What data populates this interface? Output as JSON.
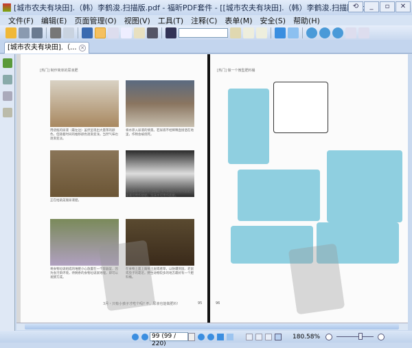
{
  "window": {
    "title": "[城市农夫有块田].（韩）李鹤浚.扫描版.pdf - 福昕PDF套件 - [[城市农夫有块田].（韩）李鹤浚.扫描版.pdf]",
    "buttons": [
      "⟲",
      "_",
      "▫",
      "✕"
    ]
  },
  "menu": [
    "文件(F)",
    "编辑(E)",
    "页面管理(O)",
    "视图(V)",
    "工具(T)",
    "注释(C)",
    "表单(M)",
    "安全(S)",
    "帮助(H)"
  ],
  "search": {
    "value": ""
  },
  "tab": {
    "label": "[城市农夫有块田].（...",
    "close": "✕"
  },
  "left_page": {
    "header": "[热门] 制作简单的尿液肥",
    "captions": [
      "用烧瓶的尿液（最左边）虽然呈现出大量茶的颜色，但随着时间的推移颜色逐渐变浅，当然气味也逐渐变淡。",
      "将水掺入尿液的情景。若尿液不经稀释直接洒在地里，作物会被烧死。",
      "正在给蔬菜施尿液肥。",
      "在泡沫水中加入1勺白糖，1～2周后可用作追肥。尿液可用作替肥，泡沫水可用作底肥。",
      "将食物垃圾组成的堆肥小心放置在一个容器里，因为会污染环境，待剩余的食物垃圾就地埋，即可以发酵方成。",
      "在食物上面上腐殖土层或者草，以防遭到鼠、老鼠或虫子的靠近。野生动物较多的地方最好有一个肥料桶。"
    ],
    "footer": "3月・只有小孩子才吃个吗? 不，尿液也能做肥料!",
    "page_number": "95"
  },
  "right_page": {
    "header": "[热门] 做一个微型肥料桶",
    "page_number": "96"
  },
  "status": {
    "page_field": "99 (99 / 220)",
    "zoom": "180.58%"
  },
  "colors": {
    "accent": "#3b8ee0",
    "chrome": "#c9d9ef",
    "comic_blue": "#8fcfe0"
  }
}
